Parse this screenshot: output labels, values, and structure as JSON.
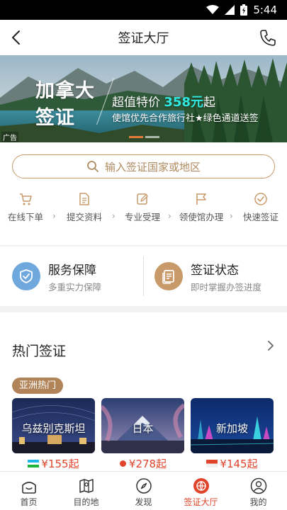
{
  "status_bar": {
    "time": "5:44"
  },
  "header": {
    "title": "签证大厅"
  },
  "banner": {
    "title_line1": "加拿大",
    "title_line2": "签证",
    "price_prefix": "超值特价",
    "price_value": "358元",
    "price_suffix": "起",
    "subtitle": "使馆优先合作旅行社★绿色通道送签",
    "ad_label": "广告"
  },
  "search": {
    "placeholder": "输入签证国家或地区"
  },
  "steps": [
    {
      "label": "在线下单",
      "icon": "cart-icon"
    },
    {
      "label": "提交资料",
      "icon": "document-icon"
    },
    {
      "label": "专业受理",
      "icon": "edit-icon"
    },
    {
      "label": "领使馆办理",
      "icon": "flag-icon"
    },
    {
      "label": "快速签证",
      "icon": "check-circle-icon"
    }
  ],
  "services": [
    {
      "title": "服务保障",
      "subtitle": "多重实力保障",
      "icon": "shield-check-icon",
      "color": "#6fa8dc"
    },
    {
      "title": "签证状态",
      "subtitle": "即时掌握办签进度",
      "icon": "document-status-icon",
      "color": "#c89a6a"
    }
  ],
  "hot": {
    "title": "热门签证",
    "tag": "亚洲热门",
    "cards": [
      {
        "name": "乌兹别克斯坦",
        "price": "¥155起",
        "flag": "uzbekistan-flag-icon"
      },
      {
        "name": "日本",
        "price": "¥278起",
        "flag": "japan-flag-icon"
      },
      {
        "name": "新加坡",
        "price": "¥145起",
        "flag": "singapore-flag-icon"
      }
    ]
  },
  "tabbar": [
    {
      "label": "首页",
      "icon": "home-icon"
    },
    {
      "label": "目的地",
      "icon": "map-icon"
    },
    {
      "label": "发现",
      "icon": "compass-icon"
    },
    {
      "label": "签证大厅",
      "icon": "visa-globe-icon",
      "active": true
    },
    {
      "label": "我的",
      "icon": "profile-icon"
    }
  ],
  "colors": {
    "accent": "#e0442a",
    "gold": "#c89a6a",
    "price": "#e0442a"
  }
}
